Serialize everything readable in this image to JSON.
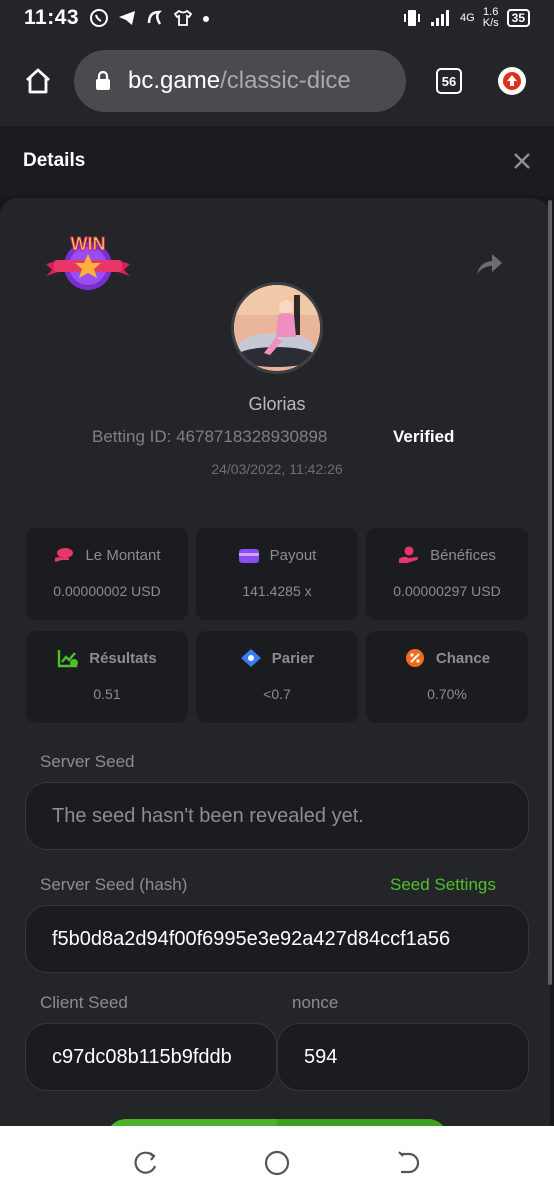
{
  "status_bar": {
    "time": "11:43",
    "network": "4G",
    "speed_value": "1.6",
    "speed_unit": "K/s",
    "battery": "35"
  },
  "browser": {
    "url_domain": "bc.game",
    "url_path": "/classic-dice",
    "tab_count": "56"
  },
  "details": {
    "title": "Details",
    "close_label": "✕"
  },
  "player": {
    "name": "Glorias",
    "betting_id_label": "Betting ID: 4678718328930898",
    "verified_label": "Verified",
    "timestamp": "24/03/2022, 11:42:26"
  },
  "stats": [
    {
      "label": "Le Montant",
      "value": "0.00000002 USD",
      "icon": "coins-icon",
      "color": "#e8366a"
    },
    {
      "label": "Payout",
      "value": "141.4285 x",
      "icon": "wallet-icon",
      "color": "#8a4cf0"
    },
    {
      "label": "Bénéfices",
      "value": "0.00000297 USD",
      "icon": "profit-hand-icon",
      "color": "#e8366a"
    },
    {
      "label": "Résultats",
      "value": "0.51",
      "icon": "chart-check-icon",
      "color": "#4fc02b"
    },
    {
      "label": "Parier",
      "value": "<0.7",
      "icon": "target-diamond-icon",
      "color": "#3b7bf5"
    },
    {
      "label": "Chance",
      "value": "0.70%",
      "icon": "percent-icon",
      "color": "#f26b1d"
    }
  ],
  "seeds": {
    "server_seed_label": "Server Seed",
    "server_seed_value": "The seed hasn't been revealed yet.",
    "server_hash_label": "Server Seed (hash)",
    "seed_settings_label": "Seed Settings",
    "server_hash_value": "f5b0d8a2d94f00f6995e3e92a427d84ccf1a56",
    "client_seed_label": "Client Seed",
    "client_seed_value": "c97dc08b115b9fddb",
    "nonce_label": "nonce",
    "nonce_value": "594"
  },
  "colors": {
    "accent_green": "#4fc02b",
    "panel": "#242528",
    "card": "#1b1c1f"
  }
}
